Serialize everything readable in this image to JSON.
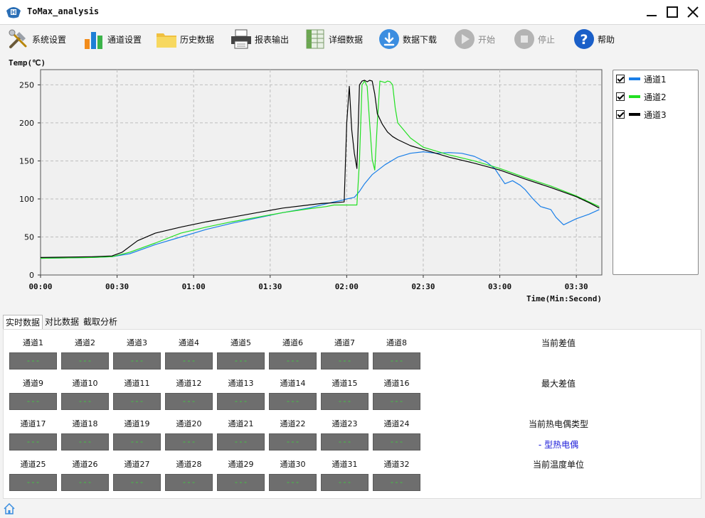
{
  "window": {
    "title": "ToMax_analysis"
  },
  "toolbar": [
    {
      "name": "system-settings",
      "label": "系统设置",
      "icon": "tools-icon",
      "enabled": true
    },
    {
      "name": "channel-settings",
      "label": "通道设置",
      "icon": "bar-chart-icon",
      "enabled": true
    },
    {
      "name": "history-data",
      "label": "历史数据",
      "icon": "folder-icon",
      "enabled": true
    },
    {
      "name": "report-output",
      "label": "报表输出",
      "icon": "printer-icon",
      "enabled": true
    },
    {
      "name": "detail-data",
      "label": "详细数据",
      "icon": "spreadsheet-icon",
      "enabled": true
    },
    {
      "name": "data-download",
      "label": "数据下载",
      "icon": "download-icon",
      "enabled": true
    },
    {
      "name": "start",
      "label": "开始",
      "icon": "play-icon",
      "enabled": false
    },
    {
      "name": "stop",
      "label": "停止",
      "icon": "stop-icon",
      "enabled": false
    },
    {
      "name": "help",
      "label": "帮助",
      "icon": "help-icon",
      "enabled": true
    }
  ],
  "chart_data": {
    "type": "line",
    "ylabel": "Temp(℃)",
    "xlabel": "Time(Min:Second)",
    "xlim": [
      0,
      220
    ],
    "ylim": [
      0,
      270
    ],
    "x_ticks": [
      0,
      30,
      60,
      90,
      120,
      150,
      180,
      210
    ],
    "x_tick_labels": [
      "00:00",
      "00:30",
      "01:00",
      "01:30",
      "02:00",
      "02:30",
      "03:00",
      "03:30"
    ],
    "y_ticks": [
      0,
      50,
      100,
      150,
      200,
      250
    ],
    "y_tick_labels": [
      "0",
      "50",
      "100",
      "150",
      "200",
      "250"
    ],
    "grid": true,
    "legend_position": "right",
    "series": [
      {
        "name": "通道1",
        "color": "#1a7fe8",
        "x": [
          0,
          20,
          28,
          35,
          45,
          55,
          65,
          75,
          85,
          95,
          105,
          110,
          115,
          118,
          120,
          123,
          125,
          127,
          130,
          135,
          140,
          145,
          150,
          155,
          160,
          165,
          170,
          175,
          178,
          180,
          182,
          185,
          188,
          190,
          193,
          196,
          200,
          202,
          205,
          210,
          215,
          219
        ],
        "y": [
          22,
          23,
          24,
          28,
          40,
          50,
          60,
          68,
          75,
          82,
          88,
          92,
          96,
          98,
          100,
          102,
          110,
          120,
          132,
          145,
          155,
          160,
          162,
          160,
          161,
          160,
          156,
          148,
          140,
          130,
          120,
          124,
          118,
          112,
          100,
          90,
          86,
          76,
          66,
          74,
          80,
          86
        ]
      },
      {
        "name": "通道2",
        "color": "#22e022",
        "x": [
          0,
          20,
          28,
          35,
          45,
          55,
          65,
          75,
          85,
          95,
          105,
          112,
          115,
          120,
          124,
          125,
          126,
          127,
          128,
          129,
          130,
          131,
          132,
          133,
          134,
          135,
          136,
          137,
          138,
          139,
          140,
          145,
          150,
          160,
          170,
          180,
          190,
          200,
          210,
          215,
          219
        ],
        "y": [
          22,
          23,
          24,
          30,
          42,
          55,
          63,
          70,
          76,
          82,
          87,
          90,
          92,
          92,
          92,
          150,
          250,
          255,
          248,
          200,
          152,
          138,
          200,
          255,
          254,
          253,
          255,
          254,
          250,
          220,
          200,
          180,
          168,
          158,
          150,
          140,
          128,
          117,
          104,
          96,
          90
        ]
      },
      {
        "name": "通道3",
        "color": "#000000",
        "x": [
          0,
          20,
          28,
          32,
          38,
          45,
          55,
          65,
          75,
          85,
          95,
          105,
          110,
          115,
          119,
          120,
          121,
          122,
          123,
          124,
          125,
          126,
          127,
          128,
          129,
          130,
          131,
          132,
          134,
          136,
          138,
          140,
          145,
          150,
          160,
          170,
          180,
          190,
          200,
          210,
          215,
          219
        ],
        "y": [
          23,
          24,
          25,
          30,
          45,
          55,
          63,
          70,
          76,
          82,
          88,
          92,
          94,
          95,
          96,
          200,
          248,
          190,
          160,
          140,
          250,
          255,
          256,
          254,
          256,
          255,
          238,
          212,
          198,
          188,
          182,
          178,
          170,
          165,
          155,
          147,
          138,
          126,
          115,
          103,
          95,
          88
        ]
      }
    ]
  },
  "legend": [
    {
      "label": "通道1",
      "color": "#1a7fe8",
      "checked": true
    },
    {
      "label": "通道2",
      "color": "#22e022",
      "checked": true
    },
    {
      "label": "通道3",
      "color": "#000000",
      "checked": true
    }
  ],
  "tabs": [
    {
      "label": "实时数据",
      "active": true
    },
    {
      "label": "对比数据",
      "active": false
    },
    {
      "label": "截取分析",
      "active": false
    }
  ],
  "channels": [
    {
      "label": "通道1",
      "value": "---"
    },
    {
      "label": "通道2",
      "value": "---"
    },
    {
      "label": "通道3",
      "value": "---"
    },
    {
      "label": "通道4",
      "value": "---"
    },
    {
      "label": "通道5",
      "value": "---"
    },
    {
      "label": "通道6",
      "value": "---"
    },
    {
      "label": "通道7",
      "value": "---"
    },
    {
      "label": "通道8",
      "value": "---"
    },
    {
      "label": "通道9",
      "value": "---"
    },
    {
      "label": "通道10",
      "value": "---"
    },
    {
      "label": "通道11",
      "value": "---"
    },
    {
      "label": "通道12",
      "value": "---"
    },
    {
      "label": "通道13",
      "value": "---"
    },
    {
      "label": "通道14",
      "value": "---"
    },
    {
      "label": "通道15",
      "value": "---"
    },
    {
      "label": "通道16",
      "value": "---"
    },
    {
      "label": "通道17",
      "value": "---"
    },
    {
      "label": "通道18",
      "value": "---"
    },
    {
      "label": "通道19",
      "value": "---"
    },
    {
      "label": "通道20",
      "value": "---"
    },
    {
      "label": "通道21",
      "value": "---"
    },
    {
      "label": "通道22",
      "value": "---"
    },
    {
      "label": "通道23",
      "value": "---"
    },
    {
      "label": "通道24",
      "value": "---"
    },
    {
      "label": "通道25",
      "value": "---"
    },
    {
      "label": "通道26",
      "value": "---"
    },
    {
      "label": "通道27",
      "value": "---"
    },
    {
      "label": "通道28",
      "value": "---"
    },
    {
      "label": "通道29",
      "value": "---"
    },
    {
      "label": "通道30",
      "value": "---"
    },
    {
      "label": "通道31",
      "value": "---"
    },
    {
      "label": "通道32",
      "value": "---"
    }
  ],
  "side": {
    "current_diff_label": "当前差值",
    "max_diff_label": "最大差值",
    "thermocouple_type_label": "当前热电偶类型",
    "thermocouple_type_value": "-  型热电偶",
    "temp_unit_label": "当前温度单位"
  },
  "colors": {
    "value_text": "#3cd23c",
    "value_bg": "#6e6e6e",
    "accent_blue": "#1a1ad8"
  }
}
